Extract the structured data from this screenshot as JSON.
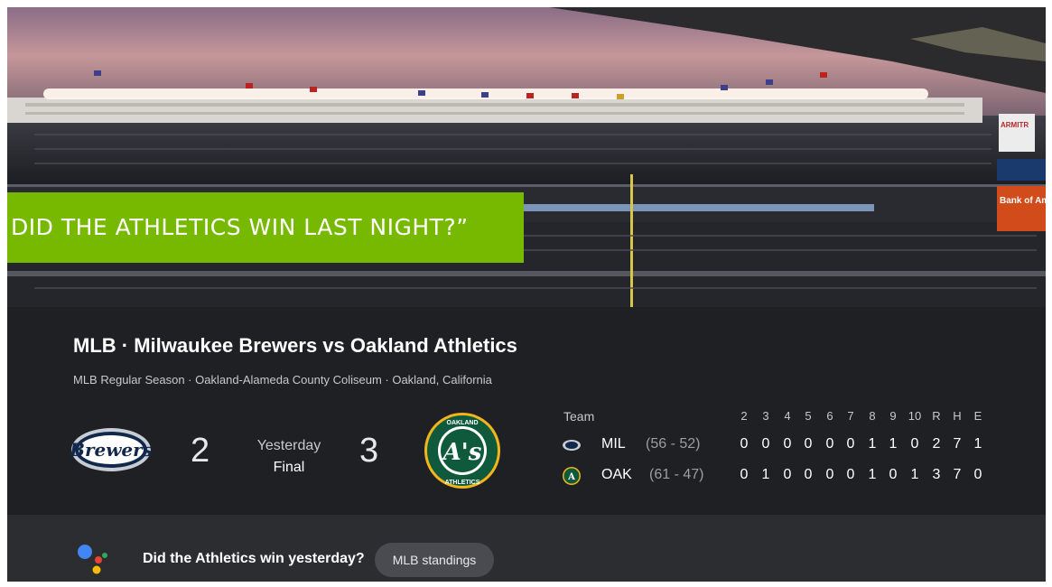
{
  "voice_query": "DID THE ATHLETICS WIN LAST NIGHT?”",
  "card": {
    "title": "MLB · Milwaukee Brewers vs Oakland Athletics",
    "subtitle": "MLB Regular Season · Oakland-Alameda County Coliseum · Oakland, California",
    "home_logo_text": "Brewers",
    "away_logo_text": "OAKLAND A's ATHLETICS",
    "score_left": "2",
    "score_right": "3",
    "status_day": "Yesterday",
    "status_final": "Final"
  },
  "box_score": {
    "team_header": "Team",
    "innings": [
      "2",
      "3",
      "4",
      "5",
      "6",
      "7",
      "8",
      "9",
      "10",
      "R",
      "H",
      "E"
    ],
    "rows": [
      {
        "abbr": "MIL",
        "record": "(56 - 52)",
        "values": [
          "0",
          "0",
          "0",
          "0",
          "0",
          "0",
          "1",
          "1",
          "0",
          "2",
          "7",
          "1"
        ],
        "icon": "brewers-icon"
      },
      {
        "abbr": "OAK",
        "record": "(61 - 47)",
        "values": [
          "0",
          "1",
          "0",
          "0",
          "0",
          "0",
          "1",
          "0",
          "1",
          "3",
          "7",
          "0"
        ],
        "icon": "athletics-icon"
      }
    ]
  },
  "assistant": {
    "prompt": "Did the Athletics win yesterday?",
    "chip": "MLB standings",
    "icon": "google-assistant-icon"
  },
  "signage": {
    "sign1": "ARMITR",
    "sign2": "Bank of Am"
  },
  "colors": {
    "banner": "#76b900",
    "card_bg": "#1f2023",
    "assistant_bg": "#2c2d31",
    "athletics_green": "#0f5a3c",
    "athletics_gold": "#f2b51b"
  }
}
